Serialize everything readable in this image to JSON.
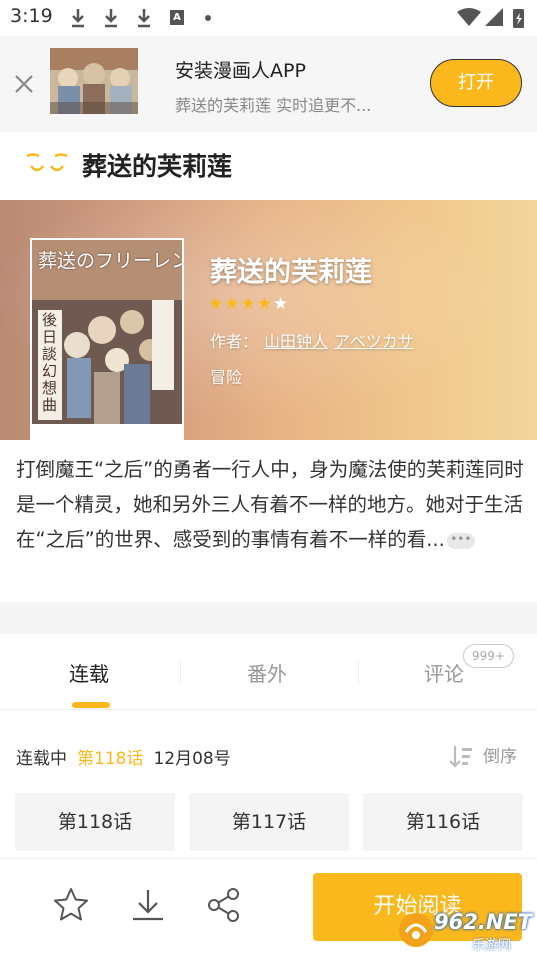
{
  "statusbar": {
    "time": "3:19"
  },
  "promo": {
    "title": "安装漫画人APP",
    "subtitle": "葬送的芙莉莲 实时追更不...",
    "open_label": "打开"
  },
  "header": {
    "title": "葬送的芙莉莲"
  },
  "comic": {
    "title": "葬送的芙莉莲",
    "rating": 4,
    "rating_max": 5,
    "author_label": "作者：",
    "authors": [
      "山田钟人",
      "アベツカサ"
    ],
    "genre": "冒险",
    "cover_text": "葬送のフリーレン",
    "cover_sub": "後日談幻想曲"
  },
  "description": {
    "text": "打倒魔王“之后”的勇者一行人中，身为魔法使的芙莉莲同时是一个精灵，她和另外三人有着不一样的地方。她对于生活在“之后”的世界、感受到的事情有着不一样的看...",
    "more": "•••"
  },
  "tabs": [
    {
      "label": "连载"
    },
    {
      "label": "番外"
    },
    {
      "label": "评论"
    }
  ],
  "comments_badge": "999+",
  "chapter_status": {
    "state": "连载中",
    "latest": "第118话",
    "date": "12月08号",
    "sort_label": "倒序"
  },
  "chapters": [
    "第118话",
    "第117话",
    "第116话"
  ],
  "bottom": {
    "read_label": "开始阅读"
  },
  "watermark": {
    "text": "962.NET",
    "sub": "乐游网"
  },
  "colors": {
    "accent": "#fbb81c",
    "text": "#222222",
    "muted": "#999999"
  }
}
